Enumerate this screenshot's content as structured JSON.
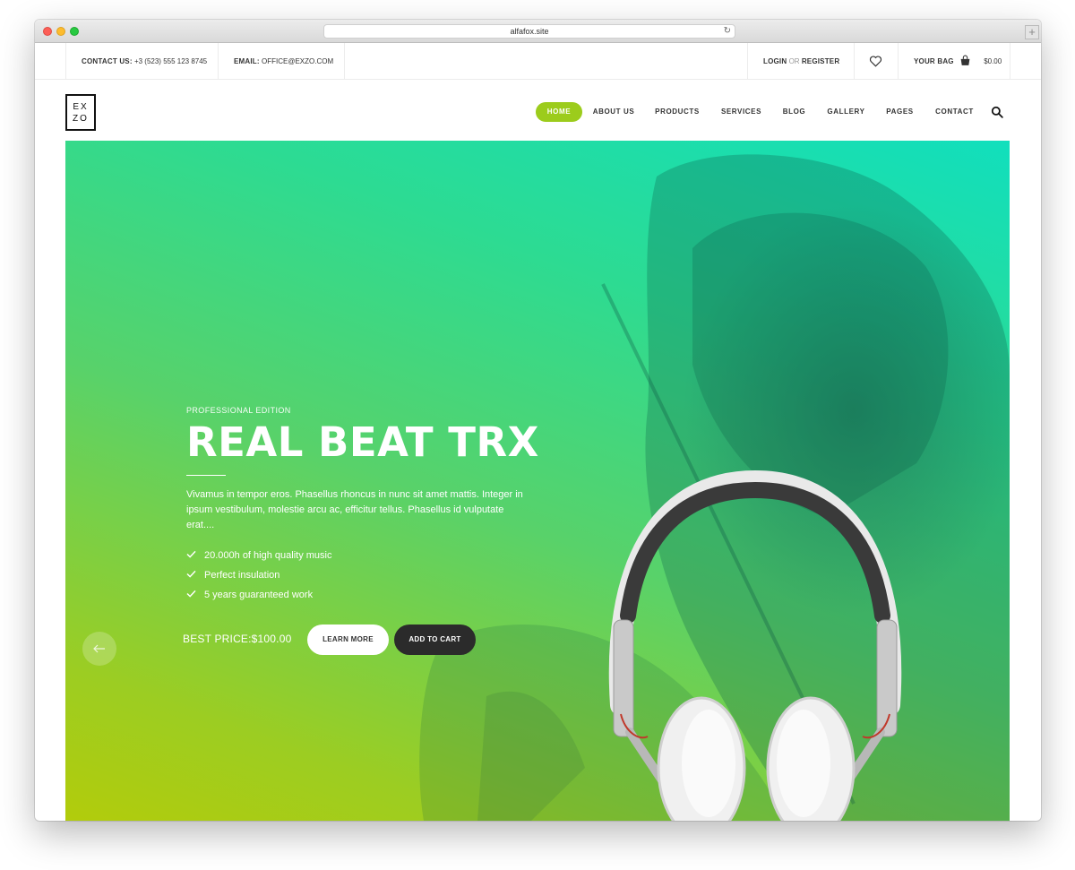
{
  "browser": {
    "url": "alfafox.site"
  },
  "topbar": {
    "contact_label": "CONTACT US:",
    "contact_value": "+3 (523) 555 123 8745",
    "email_label": "EMAIL:",
    "email_value": "OFFICE@EXZO.COM",
    "login": "LOGIN",
    "or": "OR",
    "register": "REGISTER",
    "bag_label": "YOUR BAG",
    "bag_total": "$0.00"
  },
  "header": {
    "logo_line1": "EX",
    "logo_line2": "ZO",
    "nav": [
      "HOME",
      "ABOUT US",
      "PRODUCTS",
      "SERVICES",
      "BLOG",
      "GALLERY",
      "PAGES",
      "CONTACT"
    ],
    "active_index": 0,
    "accent_color": "#9ccc1c"
  },
  "hero": {
    "edition": "PROFESSIONAL EDITION",
    "title": "REAL BEAT TRX",
    "description": "Vivamus in tempor eros. Phasellus rhoncus in nunc sit amet mattis. Integer in ipsum vestibulum, molestie arcu ac, efficitur tellus. Phasellus id vulputate erat....",
    "features": [
      "20.000h of high quality music",
      "Perfect insulation",
      "5 years guaranteed work"
    ],
    "price": "BEST PRICE:$100.00",
    "learn_more": "LEARN MORE",
    "add_to_cart": "ADD TO CART",
    "prev_icon": "arrow-left-icon",
    "next_icon": "arrow-right-icon"
  }
}
